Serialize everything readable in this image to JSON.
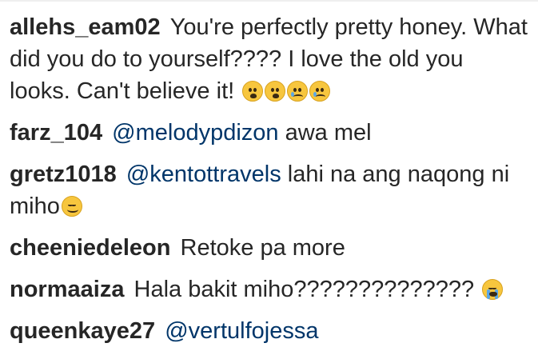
{
  "comments": [
    {
      "username": "allehs_eam02",
      "text": "You're perfectly pretty honey. What did you do to yourself???? I love the old you looks. Can't believe it!",
      "emojis": [
        "anguished-face-icon",
        "anguished-face-icon",
        "crying-face-icon",
        "crying-face-icon"
      ]
    },
    {
      "username": "farz_104",
      "mention": "@melodypdizon",
      "text": "awa mel"
    },
    {
      "username": "gretz1018",
      "mention": "@kentottravels",
      "text": "lahi na ang naqong ni miho",
      "emojis": [
        "smiling-face-icon"
      ]
    },
    {
      "username": "cheeniedeleon",
      "text": "Retoke pa more"
    },
    {
      "username": "normaaiza",
      "text": "Hala bakit miho??????????????",
      "emojis": [
        "loudly-crying-face-icon"
      ]
    },
    {
      "username": "queenkaye27",
      "mention": "@vertulfojessa"
    }
  ],
  "colors": {
    "text": "#262626",
    "mention": "#003569",
    "emoji": "#f7c63e"
  }
}
